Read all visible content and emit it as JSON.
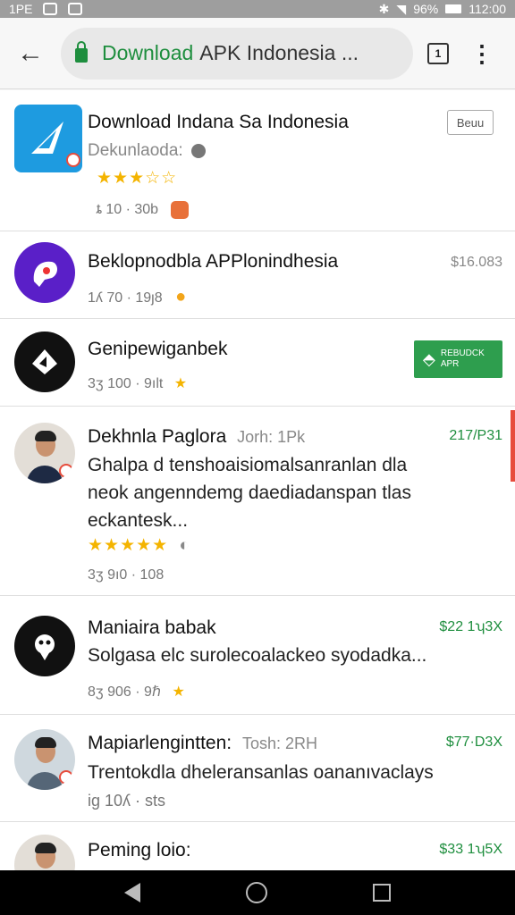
{
  "status_bar": {
    "carrier": "1PE",
    "battery": "96%",
    "time": "112:00"
  },
  "browser": {
    "url_highlight": "Download",
    "url_rest": "APK Indonesia ...",
    "tab_count": "1"
  },
  "results": [
    {
      "title": "Download Indana Sa Indonesia",
      "subtitle": "Dekunlaoda:",
      "stars": "★★★☆☆",
      "meta": "ȶ 10 · 30b",
      "button": "Beuu"
    },
    {
      "title": "Beklopnodbla APPlonindhesia",
      "meta": "1ʎ 70 · 19ȷ8",
      "price": "$16.083"
    },
    {
      "title": "Genipewiganbek",
      "meta": "3ʒ 100 · 9ılt",
      "button_line1": "REBUDCK",
      "button_line2": "APR"
    },
    {
      "title": "Dekhnla Paglora",
      "title_sub": "Jorh: 1Pk",
      "description": "Ghalpa d tenshoaisiomalsanranlan dla neok angenndemg daediadanspan tlas eckantesk...",
      "stars": "★★★★★",
      "meta": "3ʒ 9ı0 · 108",
      "price": "217/P31"
    },
    {
      "title": "Maniaira babak",
      "description": "Solgasa elc surolecoalackeo syodadka...",
      "meta": "8ʒ 906 · 9ℏ",
      "price": "$22 1ʮ3X"
    },
    {
      "title": "Mapiarlengintten:",
      "title_sub": "Tosh: 2RH",
      "description": "Trentokdla dheleransanlas oananıvaclays",
      "meta": "ig 10ʎ · sts",
      "price": "$77·D3X"
    },
    {
      "title": "Peming loio:",
      "price": "$33 1ʮ5X"
    }
  ],
  "colors": {
    "accent_green": "#1e8e3e",
    "star_gold": "#f4b400"
  }
}
